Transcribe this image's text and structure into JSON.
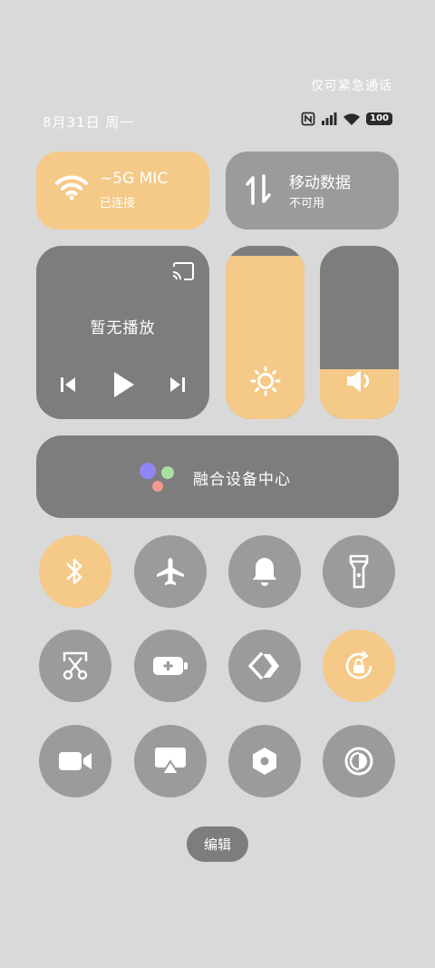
{
  "status_bar": {
    "emergency_text": "仅可紧急通话",
    "date": "8月31日 周一",
    "battery": "100",
    "icons": [
      "nfc-icon",
      "signal-icon",
      "wifi-icon",
      "battery-icon"
    ]
  },
  "wifi_tile": {
    "title": "~5G     MIC",
    "subtitle": "已连接",
    "state": "on",
    "icon": "wifi-icon"
  },
  "data_tile": {
    "title": "移动数据",
    "subtitle": "不可用",
    "state": "off",
    "icon": "mobile-data-icon"
  },
  "media": {
    "status": "暂无播放",
    "icons": [
      "cast-icon",
      "previous-icon",
      "play-icon",
      "next-icon"
    ]
  },
  "brightness": {
    "level_percent": 94,
    "icon": "brightness-icon"
  },
  "volume": {
    "level_percent": 29,
    "icon": "volume-icon"
  },
  "fusion_center": {
    "label": "融合设备中心",
    "icon": "fusion-device-icon"
  },
  "toggles": [
    {
      "name": "bluetooth",
      "icon": "bluetooth-icon",
      "state": "on"
    },
    {
      "name": "airplane-mode",
      "icon": "airplane-icon",
      "state": "off"
    },
    {
      "name": "sound",
      "icon": "bell-icon",
      "state": "off"
    },
    {
      "name": "flashlight",
      "icon": "flashlight-icon",
      "state": "off"
    },
    {
      "name": "screenshot",
      "icon": "screenshot-scissors-icon",
      "state": "off"
    },
    {
      "name": "battery-saver",
      "icon": "battery-saver-icon",
      "state": "off"
    },
    {
      "name": "nearby-share",
      "icon": "nearby-share-icon",
      "state": "off"
    },
    {
      "name": "rotation-lock",
      "icon": "rotation-lock-icon",
      "state": "on"
    },
    {
      "name": "screen-recorder",
      "icon": "video-camera-icon",
      "state": "off"
    },
    {
      "name": "screen-cast",
      "icon": "screen-cast-icon",
      "state": "off"
    },
    {
      "name": "settings",
      "icon": "settings-nut-icon",
      "state": "off"
    },
    {
      "name": "dark-mode",
      "icon": "dark-mode-icon",
      "state": "off"
    }
  ],
  "colors": {
    "active": "#f5c987",
    "inactive": "#9b9b9b",
    "panel": "#7d7d7d",
    "background": "#d9d9d9"
  },
  "edit_button": {
    "label": "编辑"
  }
}
